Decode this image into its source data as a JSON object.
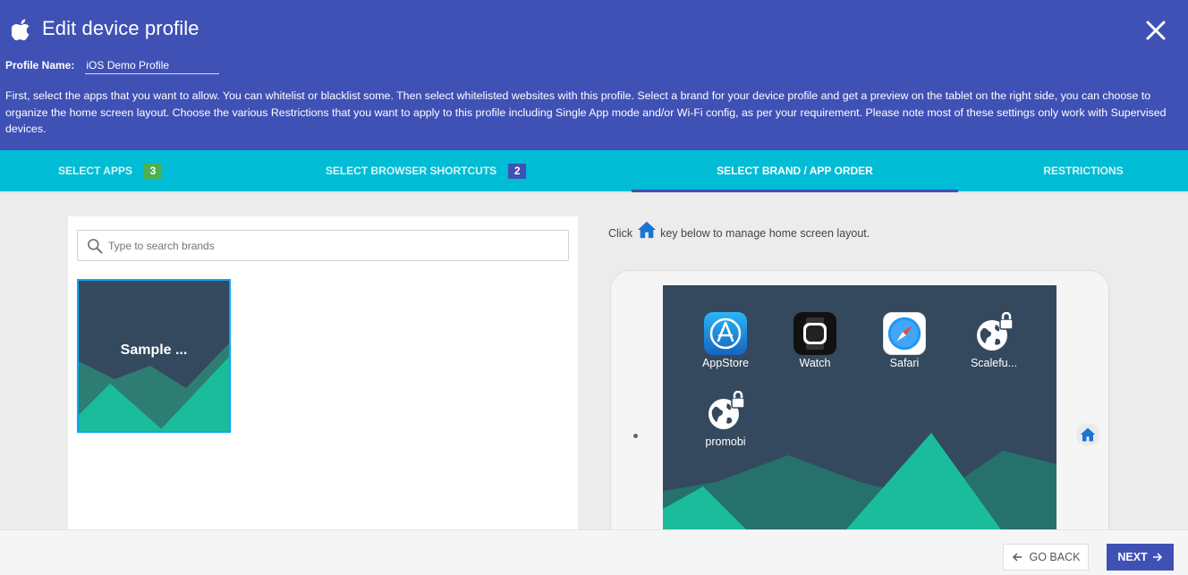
{
  "header": {
    "title": "Edit device profile",
    "profile_name_label": "Profile Name:",
    "profile_name_value": "iOS Demo Profile",
    "description": "First, select the apps that you want to allow. You can whitelist or blacklist some. Then select whitelisted websites with this profile. Select a brand for your device profile and get a preview on the tablet on the right side, you can choose to organize the home screen layout. Choose the various Restrictions that you want to apply to this profile including Single App mode and/or Wi-Fi config, as per your requirement. Please note most of these settings only work with Supervised devices.",
    "icon": "apple-icon",
    "close_icon": "close-icon"
  },
  "tabs": [
    {
      "label": "SELECT APPS",
      "badge": "3",
      "badge_color": "#4caf50",
      "active": false
    },
    {
      "label": "SELECT BROWSER SHORTCUTS",
      "badge": "2",
      "badge_color": "#3f51b5",
      "active": false
    },
    {
      "label": "SELECT BRAND / APP ORDER",
      "active": true
    },
    {
      "label": "RESTRICTIONS",
      "active": false
    }
  ],
  "brands": {
    "search_placeholder": "Type to search brands",
    "items": [
      {
        "name": "Sample ...",
        "selected": true
      }
    ]
  },
  "preview": {
    "hint_before": "Click",
    "hint_after": "key below to manage home screen layout.",
    "hint_icon": "home-icon",
    "apps": [
      {
        "label": "AppStore",
        "icon": "appstore-icon"
      },
      {
        "label": "Watch",
        "icon": "watch-icon"
      },
      {
        "label": "Safari",
        "icon": "safari-icon"
      },
      {
        "label": "Scalefu...",
        "icon": "globe-lock-icon"
      },
      {
        "label": "promobi",
        "icon": "globe-lock-icon"
      }
    ]
  },
  "footer": {
    "back_label": "GO BACK",
    "next_label": "NEXT"
  },
  "colors": {
    "header": "#3f51b5",
    "tabs": "#00bcd4",
    "accent": "#03a9f4",
    "brand_dark": "#34495e",
    "brand_green": "#1abc9c"
  }
}
